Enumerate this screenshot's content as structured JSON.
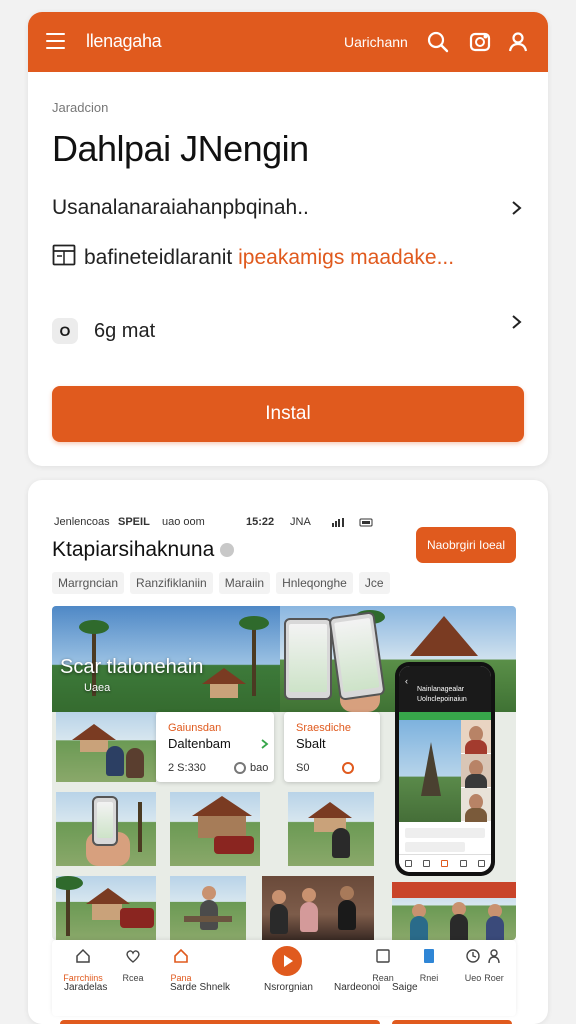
{
  "topbar": {
    "title": "llenagaha",
    "user": "Uarichann",
    "accent": "#e05a1e"
  },
  "main": {
    "breadcrumb": "Jaradcion",
    "heading": "Dahlpai JNengin",
    "link_row": "Usanalanaraiahanpbqinah..",
    "warning_text": "bafineteidlaranit",
    "warning_highlight": "ipeakamigs maadake...",
    "badge": "O",
    "option_row": "6g mat",
    "install": "Instal"
  },
  "panel": {
    "status_left": "Jenlencoas",
    "status_brand": "SPEIL",
    "status_carrier": "uao oom",
    "status_time": "15:22",
    "status_ju": "JNA",
    "heading": "Ktapiarsihaknuna",
    "primary_button": "Naobrgiri Ioeal",
    "chips": [
      "Marrgncian",
      "Ranzifiklaniin",
      "Maraiin",
      "Hnleqonghe",
      "Jce"
    ]
  },
  "gallery": {
    "hero_title": "Scar tlalonehain",
    "hero_sub": "Uaea",
    "card1_label": "Gaiunsdan",
    "card1_title": "Daltenbam",
    "card1_meta": "2 S:330",
    "card1_toggle": "bao",
    "card2_label": "Sraesdiche",
    "card2_title": "Sbalt",
    "card2_meta": "S0",
    "phone_line1": "Nainlanagealar",
    "phone_line2": "Uolnclepoinaiun"
  },
  "bottomnav": {
    "items": [
      {
        "label": "Farrchiins",
        "icon": "home-icon"
      },
      {
        "label": "Rcea",
        "icon": "heart-icon"
      },
      {
        "label": "Pana",
        "icon": "house-icon"
      },
      {
        "label": "Rean",
        "icon": "square-icon"
      },
      {
        "label": "Rnei",
        "icon": "bookmark-icon"
      },
      {
        "label": "Ueo",
        "icon": "clock-icon"
      },
      {
        "label": "Roer",
        "icon": "person-icon"
      }
    ],
    "sub_labels": [
      "Jaradelas",
      "Sarde Shnelk",
      "Nsrorgnian",
      "Nardeonoi",
      "Saige"
    ]
  }
}
